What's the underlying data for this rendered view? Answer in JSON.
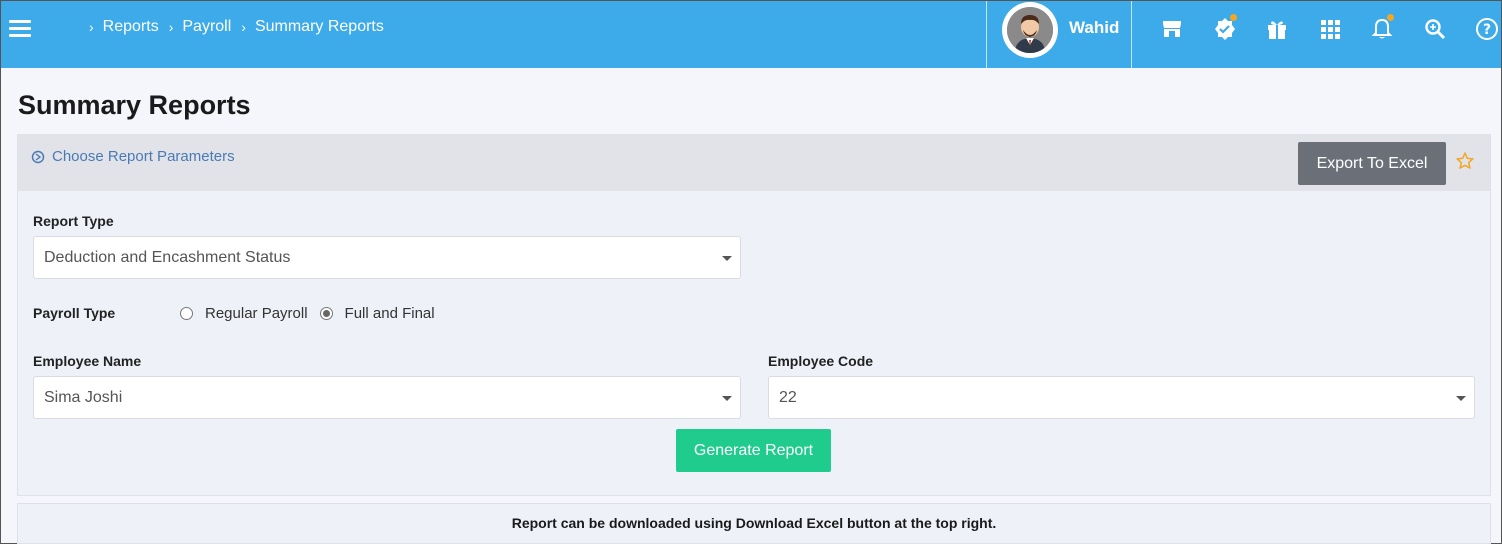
{
  "header": {
    "breadcrumb": [
      "Reports",
      "Payroll",
      "Summary Reports"
    ],
    "breadcrumb_sep": "›",
    "username": "Wahid",
    "background": "#3daaea",
    "icons": [
      "store-icon",
      "verified-badge-icon",
      "gift-icon",
      "apps-grid-icon",
      "bell-icon",
      "search-zoom-icon",
      "help-icon"
    ]
  },
  "page": {
    "title": "Summary Reports"
  },
  "panel": {
    "title": "Choose Report Parameters",
    "export_label": "Export To Excel",
    "report_type": {
      "label": "Report Type",
      "value": "Deduction and Encashment Status"
    },
    "payroll_type": {
      "label": "Payroll Type",
      "options": [
        "Regular Payroll",
        "Full and Final"
      ],
      "selected": "Full and Final"
    },
    "employee_name": {
      "label": "Employee Name",
      "value": "Sima Joshi"
    },
    "employee_code": {
      "label": "Employee Code",
      "value": "22"
    },
    "generate_label": "Generate Report"
  },
  "footer": {
    "note": "Report can be downloaded using Download Excel button at the top right."
  },
  "colors": {
    "accent": "#3daaea",
    "success": "#1fcc8e",
    "star": "#f5a623"
  }
}
